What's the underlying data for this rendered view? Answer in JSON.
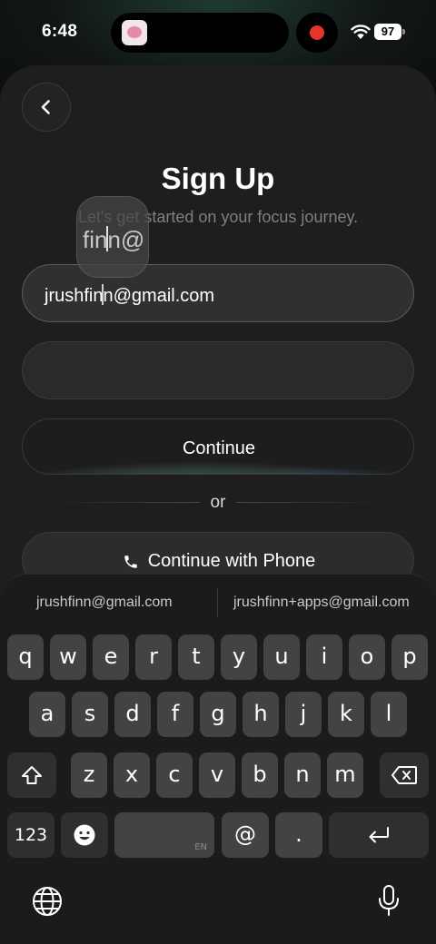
{
  "status_bar": {
    "time": "6:48",
    "battery": "97",
    "recording": true
  },
  "header": {
    "title": "Sign Up",
    "subtitle": "Let's get started on your focus journey.",
    "back_icon": "chevron-left-icon"
  },
  "form": {
    "email_before_cursor": "jrushfin",
    "email_after_cursor": "n@gmail.com",
    "password_value": "",
    "magnifier_before": "fin",
    "magnifier_after": "n@",
    "continue_label": "Continue",
    "divider_label": "or",
    "phone_label": "Continue with Phone",
    "phone_icon": "phone-icon"
  },
  "keyboard": {
    "suggestions": [
      "jrushfinn@gmail.com",
      "jrushfinn+apps@gmail.com"
    ],
    "rows": [
      [
        "q",
        "w",
        "e",
        "r",
        "t",
        "y",
        "u",
        "i",
        "o",
        "p"
      ],
      [
        "a",
        "s",
        "d",
        "f",
        "g",
        "h",
        "j",
        "k",
        "l"
      ],
      [
        "z",
        "x",
        "c",
        "v",
        "b",
        "n",
        "m"
      ]
    ],
    "numbers_key": "123",
    "at_key": "@",
    "period_key": ".",
    "space_language": "EN",
    "icons": [
      "shift-icon",
      "backspace-icon",
      "emoji-icon",
      "return-icon",
      "globe-icon",
      "microphone-icon"
    ]
  },
  "colors": {
    "background": "#0c0d0d",
    "sheet": "#1e1e1f",
    "key": "#434345",
    "recording": "#e8322c"
  }
}
